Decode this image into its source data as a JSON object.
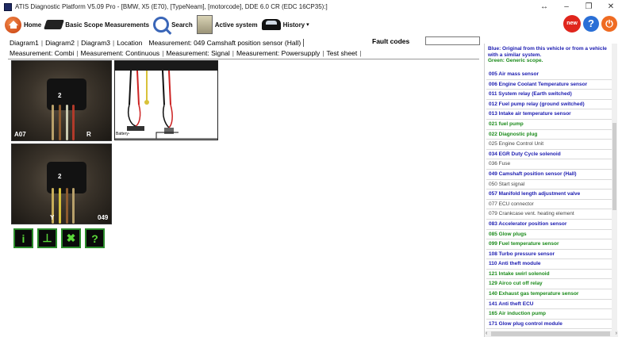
{
  "window": {
    "title": "ATIS Diagnostic Platform V5.09 Pro - [BMW, X5 (E70), [TypeNeam], [motorcode], DDE 6.0 CR (EDC 16CP35):]",
    "controls": [
      "↔",
      "–",
      "❐",
      "✕"
    ]
  },
  "toolbar": {
    "home": "Home",
    "basic_scope": "Basic Scope Measurements",
    "search": "Search",
    "active_system": "Active system",
    "history": "History",
    "caret": "▾",
    "new_badge": "new",
    "help": "?",
    "power": "⏻"
  },
  "tabs_top": {
    "items": [
      "Diagram1",
      "Diagram2",
      "Diagram3",
      "Location"
    ],
    "measurement_title": "Measurement: 049 Camshaft position sensor (Hall)",
    "fault_codes_label": "Fault codes",
    "fault_codes_value": ""
  },
  "tabs_meas": {
    "items": [
      "Measurement: Combi",
      "Measurement: Continuous",
      "Measurement: Signal",
      "Measurement: Powersupply",
      "Test sheet"
    ]
  },
  "main": {
    "photo1": {
      "label_left": "A07",
      "label_num": "2",
      "label_right": "R"
    },
    "photo2": {
      "label_left": "Y",
      "label_num": "2",
      "label_right": "049"
    },
    "diagram": {
      "battery_label": "Battery-"
    },
    "icons": [
      "info-icon",
      "waveform-icon",
      "tools-icon",
      "help-icon"
    ],
    "icon_glyphs": [
      "i",
      "⊥",
      "✖",
      "?"
    ]
  },
  "right_panel": {
    "legend_blue": "Blue: Original from this vehicle or from a vehicle with a similar system.",
    "legend_green": "Green: Generic scope.",
    "items": [
      {
        "label": "005 Air mass sensor",
        "color": "blue"
      },
      {
        "label": "006 Engine Coolant Temperature sensor",
        "color": "blue"
      },
      {
        "label": "011 System relay (Earth switched)",
        "color": "blue"
      },
      {
        "label": "012 Fuel pump relay (ground switched)",
        "color": "blue"
      },
      {
        "label": "013 Intake air temperature sensor",
        "color": "blue"
      },
      {
        "label": "021 fuel pump",
        "color": "green"
      },
      {
        "label": "022 Diagnostic plug",
        "color": "green"
      },
      {
        "label": "025 Engine Control Unit",
        "color": "gray"
      },
      {
        "label": "034 EGR Duty Cycle solenoid",
        "color": "blue"
      },
      {
        "label": "036 Fuse",
        "color": "gray"
      },
      {
        "label": "049 Camshaft position sensor (Hall)",
        "color": "blue"
      },
      {
        "label": "050 Start signal",
        "color": "gray"
      },
      {
        "label": "057 Manifold length adjustment valve",
        "color": "blue"
      },
      {
        "label": "077 ECU connector",
        "color": "gray"
      },
      {
        "label": "079 Crankcase vent. heating element",
        "color": "gray"
      },
      {
        "label": "083 Accelerator position sensor",
        "color": "blue"
      },
      {
        "label": "085 Glow plugs",
        "color": "green"
      },
      {
        "label": "099 Fuel temperature sensor",
        "color": "green"
      },
      {
        "label": "108 Turbo pressure sensor",
        "color": "blue"
      },
      {
        "label": "110 Anti theft module",
        "color": "blue"
      },
      {
        "label": "121 Intake swirl solenoid",
        "color": "green"
      },
      {
        "label": "129 Airco cut off relay",
        "color": "green"
      },
      {
        "label": "140 Exhaust gas temperature sensor",
        "color": "green"
      },
      {
        "label": "141 Anti theft ECU",
        "color": "blue"
      },
      {
        "label": "165 Air induction pump",
        "color": "green"
      },
      {
        "label": "171 Glow plug control module",
        "color": "blue"
      }
    ],
    "colors": {
      "blue": "#1a1ab0",
      "green": "#1a8a1a",
      "gray": "#444444"
    }
  }
}
